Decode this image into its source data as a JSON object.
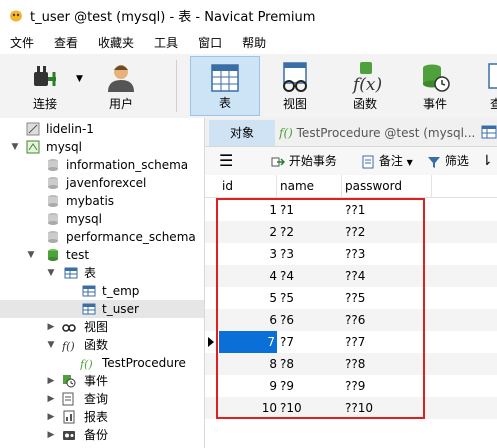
{
  "window": {
    "title": "t_user @test (mysql) - 表 - Navicat Premium"
  },
  "menu": [
    "文件",
    "查看",
    "收藏夹",
    "工具",
    "窗口",
    "帮助"
  ],
  "toolbar": {
    "connect": "连接",
    "user": "用户",
    "table": "表",
    "view": "视图",
    "function": "函数",
    "event": "事件",
    "query_partial": "查"
  },
  "tree": {
    "items": [
      {
        "label": "lidelin-1"
      },
      {
        "label": "mysql"
      },
      {
        "label": "information_schema"
      },
      {
        "label": "javenforexcel"
      },
      {
        "label": "mybatis"
      },
      {
        "label": "mysql"
      },
      {
        "label": "performance_schema"
      },
      {
        "label": "test"
      },
      {
        "label": "表"
      },
      {
        "label": "t_emp"
      },
      {
        "label": "t_user"
      },
      {
        "label": "视图"
      },
      {
        "label": "函数"
      },
      {
        "label": "TestProcedure"
      },
      {
        "label": "事件"
      },
      {
        "label": "查询"
      },
      {
        "label": "报表"
      },
      {
        "label": "备份"
      }
    ]
  },
  "tabs": {
    "objects": "对象",
    "procedure": "TestProcedure @test (mysql..."
  },
  "subtoolbar": {
    "begin_transaction": "开始事务",
    "memo": "备注",
    "filter": "筛选"
  },
  "grid": {
    "columns": [
      "id",
      "name",
      "password"
    ],
    "rows": [
      {
        "id": "1",
        "name": "?1",
        "password": "??1"
      },
      {
        "id": "2",
        "name": "?2",
        "password": "??2"
      },
      {
        "id": "3",
        "name": "?3",
        "password": "??3"
      },
      {
        "id": "4",
        "name": "?4",
        "password": "??4"
      },
      {
        "id": "5",
        "name": "?5",
        "password": "??5"
      },
      {
        "id": "6",
        "name": "?6",
        "password": "??6"
      },
      {
        "id": "7",
        "name": "?7",
        "password": "??7"
      },
      {
        "id": "8",
        "name": "?8",
        "password": "??8"
      },
      {
        "id": "9",
        "name": "?9",
        "password": "??9"
      },
      {
        "id": "10",
        "name": "?10",
        "password": "??10"
      }
    ]
  },
  "colors": {
    "accent": "#0a6fd6",
    "highlight_box": "#e02020",
    "active_tab": "#cfe3f5"
  }
}
